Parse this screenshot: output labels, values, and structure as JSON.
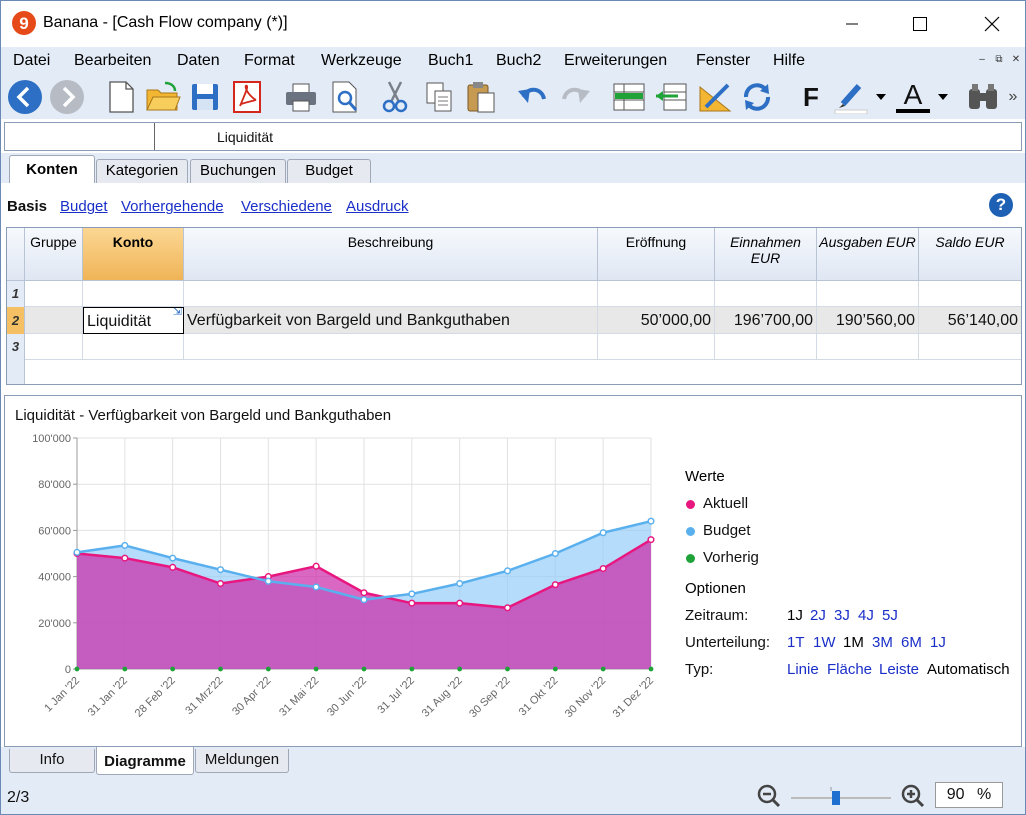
{
  "window": {
    "title": "Banana - [Cash Flow company (*)]",
    "logo_text": "9"
  },
  "menu": [
    "Datei",
    "Bearbeiten",
    "Daten",
    "Format",
    "Werkzeuge",
    "Buch1",
    "Buch2",
    "Erweiterungen",
    "Fenster",
    "Hilfe"
  ],
  "toolbar": {
    "icons": [
      "back-icon",
      "forward-icon",
      "new-file-icon",
      "open-folder-icon",
      "save-icon",
      "pdf-icon",
      "print-icon",
      "print-preview-icon",
      "cut-icon",
      "copy-icon",
      "paste-icon",
      "undo-icon",
      "redo-icon",
      "insert-rows-icon",
      "move-rows-icon",
      "edit-pencil-icon",
      "recheck-icon",
      "bold-icon",
      "highlight-icon",
      "font-color-icon",
      "find-binoculars-icon"
    ],
    "bold_label": "F",
    "font_color_label": "A",
    "more_label": "»"
  },
  "cell_value": "Liquidität",
  "tabs": [
    "Konten",
    "Kategorien",
    "Buchungen",
    "Budget"
  ],
  "active_tab": "Konten",
  "views": {
    "current": "Basis",
    "links": [
      "Budget",
      "Vorhergehende",
      "Verschiedene",
      "Ausdruck"
    ]
  },
  "help_label": "?",
  "table": {
    "columns": [
      "Gruppe",
      "Konto",
      "Beschreibung",
      "Eröffnung",
      "Einnahmen EUR",
      "Ausgaben EUR",
      "Saldo EUR"
    ],
    "rows": [
      {
        "num": "1",
        "gruppe": "",
        "konto": "",
        "beschreibung": "",
        "eroeffnung": "",
        "einnahmen": "",
        "ausgaben": "",
        "saldo": ""
      },
      {
        "num": "2",
        "gruppe": "",
        "konto": "Liquidität",
        "beschreibung": "Verfügbarkeit von Bargeld und Bankguthaben",
        "eroeffnung": "50’000,00",
        "einnahmen": "196’700,00",
        "ausgaben": "190’560,00",
        "saldo": "56’140,00"
      },
      {
        "num": "3",
        "gruppe": "",
        "konto": "",
        "beschreibung": "",
        "eroeffnung": "",
        "einnahmen": "",
        "ausgaben": "",
        "saldo": ""
      }
    ]
  },
  "chart_data": {
    "type": "area",
    "title": "Liquidität - Verfügbarkeit von Bargeld und Bankguthaben",
    "categories": [
      "1 Jan '22",
      "31 Jan '22",
      "28 Feb '22",
      "31 Mrz'22",
      "30 Apr '22",
      "31 Mai '22",
      "30 Jun '22",
      "31 Jul '22",
      "31 Aug '22",
      "30 Sep '22",
      "31 Okt '22",
      "30 Nov '22",
      "31 Dez '22"
    ],
    "ylim": [
      0,
      100000
    ],
    "yticks": [
      "0",
      "20'000",
      "40'000",
      "60'000",
      "80'000",
      "100'000"
    ],
    "series": [
      {
        "name": "Aktuell",
        "color": "#e8177f",
        "values": [
          50000,
          48000,
          44000,
          37000,
          40000,
          44500,
          33000,
          28500,
          28500,
          26500,
          36500,
          43500,
          56000
        ]
      },
      {
        "name": "Budget",
        "color": "#5ab0ee",
        "values": [
          50500,
          53500,
          48000,
          43000,
          38000,
          35500,
          30000,
          32500,
          37000,
          42500,
          50000,
          59000,
          64000
        ]
      },
      {
        "name": "Vorherig",
        "color": "#1fa339",
        "values": [
          0,
          0,
          0,
          0,
          0,
          0,
          0,
          0,
          0,
          0,
          0,
          0,
          0
        ]
      }
    ],
    "grid": true,
    "legend": "right"
  },
  "legend": {
    "heading": "Werte",
    "options_heading": "Optionen",
    "zeitraum_label": "Zeitraum:",
    "zeitraum": [
      "1J",
      "2J",
      "3J",
      "4J",
      "5J"
    ],
    "zeitraum_current": "1J",
    "unterteilung_label": "Unterteilung:",
    "unterteilung": [
      "1T",
      "1W",
      "1M",
      "3M",
      "6M",
      "1J"
    ],
    "unterteilung_current": "1M",
    "typ_label": "Typ:",
    "typ": [
      "Linie",
      "Fläche",
      "Leiste",
      "Automatisch"
    ],
    "typ_current": "Automatisch"
  },
  "bottom_tabs": [
    "Info",
    "Diagramme",
    "Meldungen"
  ],
  "active_bottom_tab": "Diagramme",
  "status": {
    "page": "2/3",
    "zoom_value": "90",
    "zoom_unit": "%"
  }
}
